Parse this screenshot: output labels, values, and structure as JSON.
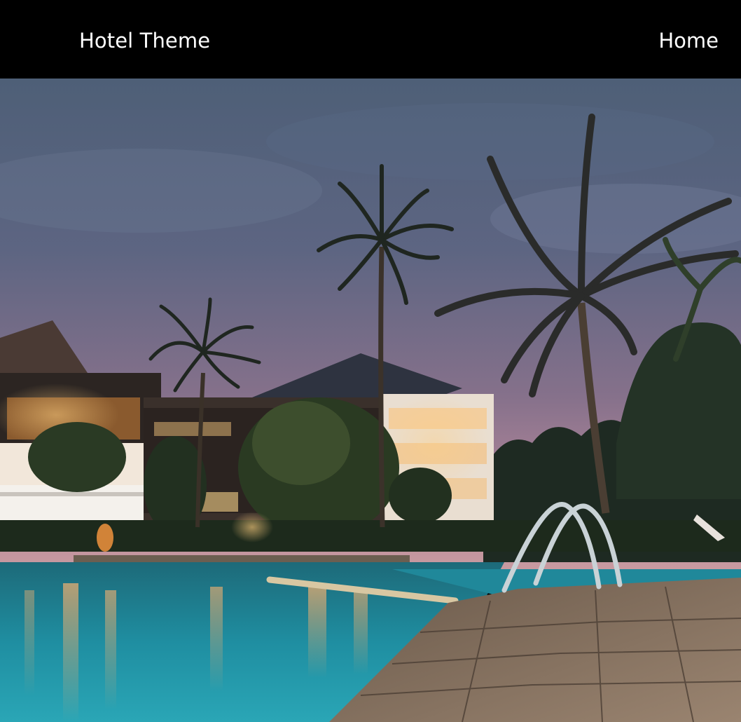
{
  "navbar": {
    "brand": "Hotel Theme",
    "links": [
      {
        "label": "Home"
      }
    ]
  },
  "hero": {
    "icon": "hotel-pool-night-photo"
  },
  "colors": {
    "navbar_bg": "#000000",
    "nav_text": "#ffffff"
  }
}
